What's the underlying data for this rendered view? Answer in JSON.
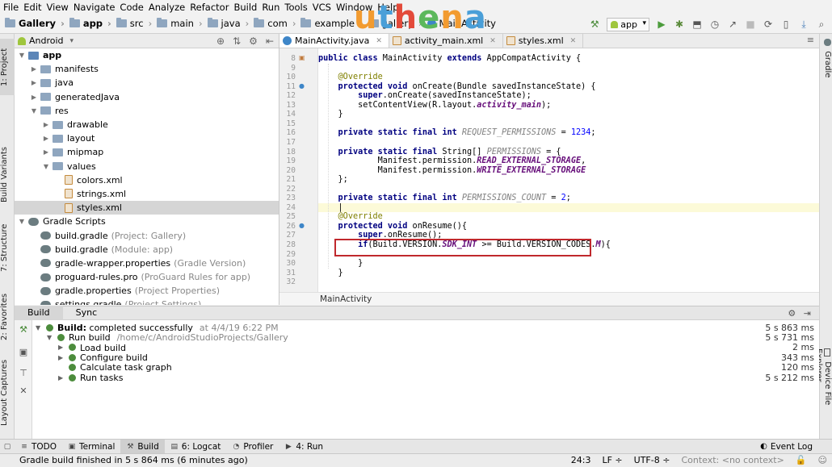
{
  "menu": [
    "File",
    "Edit",
    "View",
    "Navigate",
    "Code",
    "Analyze",
    "Refactor",
    "Build",
    "Run",
    "Tools",
    "VCS",
    "Window",
    "Help"
  ],
  "breadcrumb": [
    "Gallery",
    "app",
    "src",
    "main",
    "java",
    "com",
    "example",
    "gallery",
    "MainActivity"
  ],
  "logo": [
    "u",
    "t",
    "h",
    "e",
    "n",
    "a"
  ],
  "run_config": "app",
  "left_strip": {
    "project": "1: Project",
    "build_variants": "Build Variants",
    "structure": "7: Structure",
    "favorites": "2: Favorites",
    "layout_captures": "Layout Captures"
  },
  "right_strip": {
    "gradle": "Gradle",
    "device_file_explorer": "Device File Explorer"
  },
  "project_panel": {
    "view": "Android",
    "items": [
      {
        "label": "app",
        "hint": "",
        "depth": 0,
        "icon": "folder-b",
        "arrow": "▼",
        "bold": true
      },
      {
        "label": "manifests",
        "hint": "",
        "depth": 1,
        "icon": "folder",
        "arrow": "▶"
      },
      {
        "label": "java",
        "hint": "",
        "depth": 1,
        "icon": "folder",
        "arrow": "▶"
      },
      {
        "label": "generatedJava",
        "hint": "",
        "depth": 1,
        "icon": "folder",
        "arrow": "▶"
      },
      {
        "label": "res",
        "hint": "",
        "depth": 1,
        "icon": "folder",
        "arrow": "▼"
      },
      {
        "label": "drawable",
        "hint": "",
        "depth": 2,
        "icon": "folder",
        "arrow": "▶"
      },
      {
        "label": "layout",
        "hint": "",
        "depth": 2,
        "icon": "folder",
        "arrow": "▶"
      },
      {
        "label": "mipmap",
        "hint": "",
        "depth": 2,
        "icon": "folder",
        "arrow": "▶"
      },
      {
        "label": "values",
        "hint": "",
        "depth": 2,
        "icon": "folder",
        "arrow": "▼"
      },
      {
        "label": "colors.xml",
        "hint": "",
        "depth": 3,
        "icon": "xml",
        "arrow": ""
      },
      {
        "label": "strings.xml",
        "hint": "",
        "depth": 3,
        "icon": "xml",
        "arrow": ""
      },
      {
        "label": "styles.xml",
        "hint": "",
        "depth": 3,
        "icon": "xml",
        "arrow": "",
        "selected": true
      },
      {
        "label": "Gradle Scripts",
        "hint": "",
        "depth": 0,
        "icon": "gradle",
        "arrow": "▼"
      },
      {
        "label": "build.gradle",
        "hint": "(Project: Gallery)",
        "depth": 1,
        "icon": "gradle",
        "arrow": ""
      },
      {
        "label": "build.gradle",
        "hint": "(Module: app)",
        "depth": 1,
        "icon": "gradle",
        "arrow": ""
      },
      {
        "label": "gradle-wrapper.properties",
        "hint": "(Gradle Version)",
        "depth": 1,
        "icon": "gradle",
        "arrow": ""
      },
      {
        "label": "proguard-rules.pro",
        "hint": "(ProGuard Rules for app)",
        "depth": 1,
        "icon": "gradle",
        "arrow": ""
      },
      {
        "label": "gradle.properties",
        "hint": "(Project Properties)",
        "depth": 1,
        "icon": "gradle",
        "arrow": ""
      },
      {
        "label": "settings.gradle",
        "hint": "(Project Settings)",
        "depth": 1,
        "icon": "gradle",
        "arrow": ""
      }
    ]
  },
  "editor_tabs": [
    {
      "label": "MainActivity.java",
      "type": "java",
      "active": true
    },
    {
      "label": "activity_main.xml",
      "type": "xml",
      "active": false
    },
    {
      "label": "styles.xml",
      "type": "xml",
      "active": false
    }
  ],
  "code_lines": [
    {
      "n": "8",
      "html": "<span class=\"kw\">public class</span> MainActivity <span class=\"kw\">extends</span> AppCompatActivity {"
    },
    {
      "n": "9",
      "html": ""
    },
    {
      "n": "10",
      "html": "    <span class=\"an\">@Override</span>"
    },
    {
      "n": "11",
      "html": "    <span class=\"kw\">protected void</span> onCreate(Bundle savedInstanceState) {"
    },
    {
      "n": "12",
      "html": "        <span class=\"kw\">super</span>.onCreate(savedInstanceState);"
    },
    {
      "n": "13",
      "html": "        setContentView(R.layout.<span class=\"it\">activity_main</span>);"
    },
    {
      "n": "14",
      "html": "    }"
    },
    {
      "n": "15",
      "html": ""
    },
    {
      "n": "16",
      "html": "    <span class=\"kw\">private static final int</span> <span class=\"ci\">REQUEST_PERMISSIONS</span> = <span class=\"nm\">1234</span>;"
    },
    {
      "n": "17",
      "html": ""
    },
    {
      "n": "18",
      "html": "    <span class=\"kw\">private static final</span> String[] <span class=\"ci\">PERMISSIONS</span> = {"
    },
    {
      "n": "19",
      "html": "            Manifest.permission.<span class=\"it\">READ_EXTERNAL_STORAGE</span>,"
    },
    {
      "n": "20",
      "html": "            Manifest.permission.<span class=\"it\">WRITE_EXTERNAL_STORAGE</span>"
    },
    {
      "n": "21",
      "html": "    };"
    },
    {
      "n": "22",
      "html": ""
    },
    {
      "n": "23",
      "html": "    <span class=\"kw\">private static final int</span> <span class=\"ci\">PERMISSIONS_COUNT</span> = <span class=\"nm\">2</span>;"
    },
    {
      "n": "24",
      "html": "    |",
      "current": true
    },
    {
      "n": "25",
      "html": "    <span class=\"an\">@Override</span>"
    },
    {
      "n": "26",
      "html": "    <span class=\"kw\">protected void</span> onResume(){"
    },
    {
      "n": "27",
      "html": "        <span class=\"kw\">super</span>.onResume();"
    },
    {
      "n": "28",
      "html": "        <span class=\"kw\">if</span>(Build.VERSION.<span class=\"it\">SDK_INT</span> >= Build.VERSION_CODES.<span class=\"it\">M</span>){"
    },
    {
      "n": "29",
      "html": ""
    },
    {
      "n": "30",
      "html": "        }"
    },
    {
      "n": "31",
      "html": "    }"
    },
    {
      "n": "32",
      "html": ""
    }
  ],
  "editor_breadcrumb": "MainActivity",
  "build_panel": {
    "tabs": [
      "Build",
      "Sync"
    ],
    "rows": [
      {
        "indent": 0,
        "arrow": "▼",
        "label": "Build:",
        "bold_label": true,
        "text": " completed successfully",
        "hint": "at 4/4/19 6:22 PM",
        "time": "5 s 863 ms"
      },
      {
        "indent": 1,
        "arrow": "▼",
        "label": "Run build",
        "text": "",
        "hint": "/home/c/AndroidStudioProjects/Gallery",
        "time": "5 s 731 ms"
      },
      {
        "indent": 2,
        "arrow": "▶",
        "label": "Load build",
        "text": "",
        "hint": "",
        "time": "2 ms"
      },
      {
        "indent": 2,
        "arrow": "▶",
        "label": "Configure build",
        "text": "",
        "hint": "",
        "time": "343 ms"
      },
      {
        "indent": 2,
        "arrow": "",
        "label": "Calculate task graph",
        "text": "",
        "hint": "",
        "time": "120 ms"
      },
      {
        "indent": 2,
        "arrow": "▶",
        "label": "Run tasks",
        "text": "",
        "hint": "",
        "time": "5 s 212 ms"
      }
    ]
  },
  "bottom_tabs": [
    {
      "label": "TODO",
      "icon": "≡",
      "active": false
    },
    {
      "label": "Terminal",
      "icon": "▣",
      "active": false
    },
    {
      "label": "Build",
      "icon": "⚒",
      "active": true
    },
    {
      "label": "6: Logcat",
      "icon": "▤",
      "active": false
    },
    {
      "label": "Profiler",
      "icon": "◔",
      "active": false
    },
    {
      "label": "4: Run",
      "icon": "▶",
      "active": false
    }
  ],
  "event_log": "Event Log",
  "status": {
    "message": "Gradle build finished in 5 s 864 ms (6 minutes ago)",
    "position": "24:3",
    "line_sep": "LF ÷",
    "encoding": "UTF-8 ÷",
    "context": "Context: <no context>"
  },
  "colors": {
    "accent_green": "#4c8c3c",
    "highlight_red": "#c0282d"
  }
}
